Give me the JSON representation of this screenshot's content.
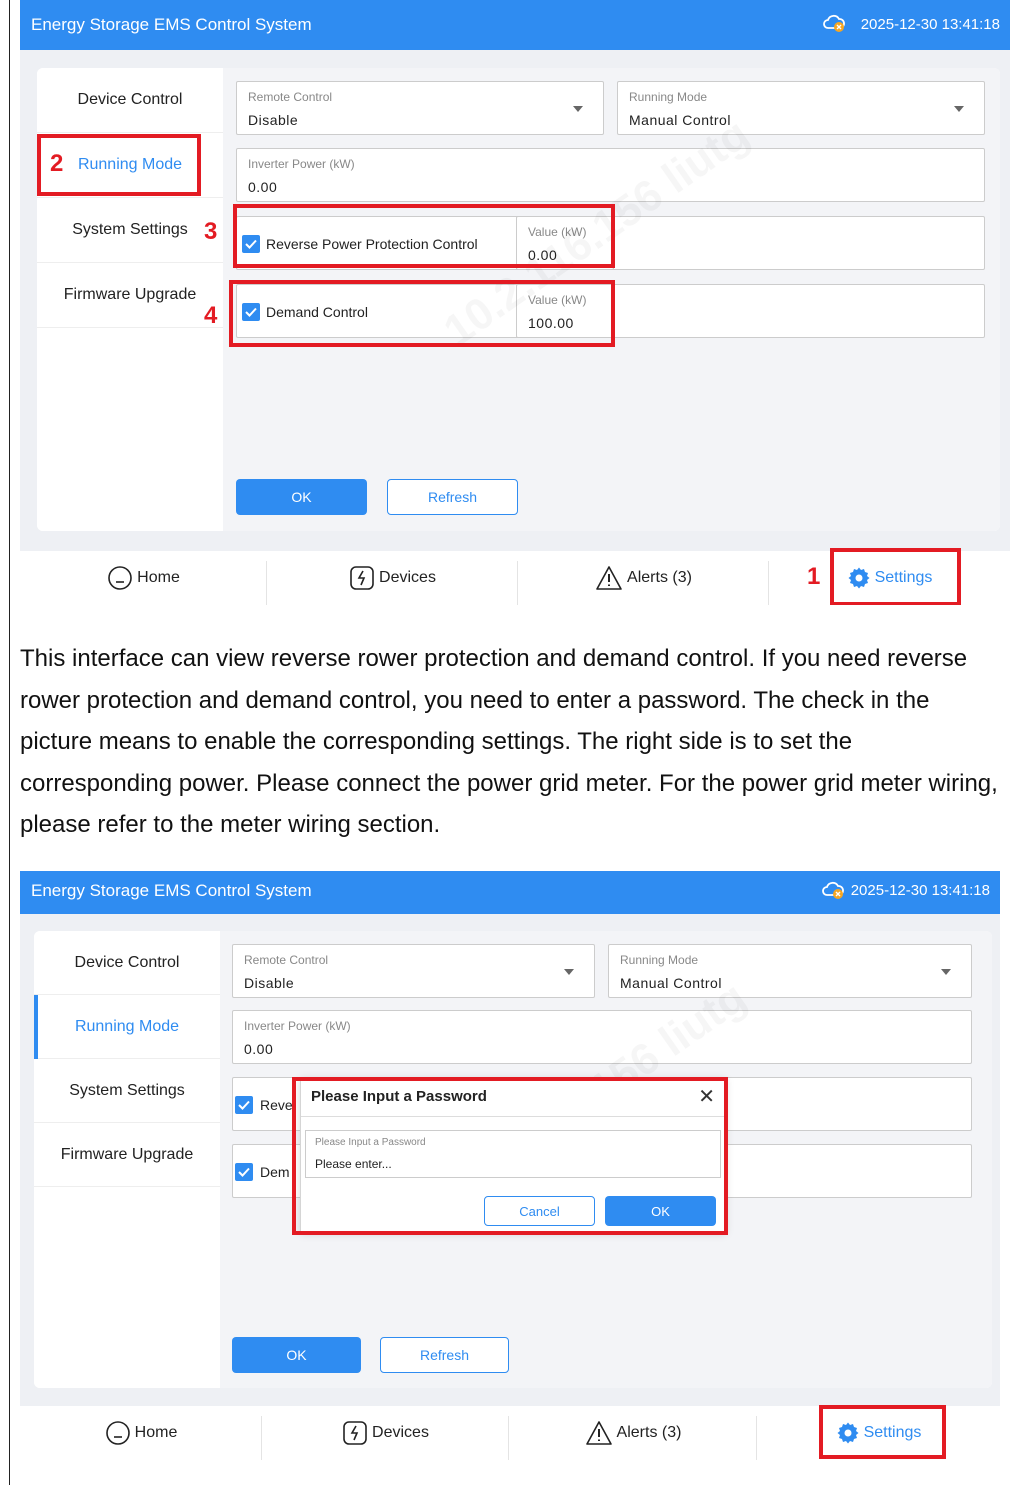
{
  "top_screen": {
    "app_title": "Energy Storage EMS Control System",
    "datetime": "2025-12-30 13:41:18",
    "nav": [
      {
        "label": "Device Control"
      },
      {
        "label": "Running Mode"
      },
      {
        "label": "System Settings"
      },
      {
        "label": "Firmware Upgrade"
      }
    ],
    "remote_control": {
      "label": "Remote Control",
      "value": "Disable"
    },
    "running_mode": {
      "label": "Running Mode",
      "value": "Manual Control"
    },
    "inverter_power": {
      "label": "Inverter Power (kW)",
      "value": "0.00"
    },
    "reverse_power": {
      "label": "Reverse Power Protection Control",
      "checked": true,
      "value_label": "Value (kW)",
      "value": "0.00"
    },
    "demand": {
      "label": "Demand Control",
      "checked": true,
      "value_label": "Value (kW)",
      "value": "100.00"
    },
    "ok_label": "OK",
    "refresh_label": "Refresh",
    "tabs": [
      {
        "label": "Home",
        "icon": "home-icon"
      },
      {
        "label": "Devices",
        "icon": "devices-icon"
      },
      {
        "label": "Alerts (3)",
        "icon": "alert-icon"
      },
      {
        "label": "Settings",
        "icon": "gear-icon"
      }
    ],
    "annotations": [
      "1",
      "2",
      "3",
      "4"
    ]
  },
  "description": "This interface can view reverse rower protection and demand control. If you need reverse rower protection and demand control, you need to enter a password. The check in the picture means to enable the corresponding settings. The right side is to set the corresponding power. Please connect the power grid meter. For the power grid meter wiring, please refer to the meter wiring section.",
  "bottom_screen": {
    "app_title": "Energy Storage EMS Control System",
    "datetime": "2025-12-30 13:41:18",
    "nav": [
      {
        "label": "Device Control"
      },
      {
        "label": "Running Mode"
      },
      {
        "label": "System Settings"
      },
      {
        "label": "Firmware Upgrade"
      }
    ],
    "remote_control": {
      "label": "Remote Control",
      "value": "Disable"
    },
    "running_mode": {
      "label": "Running Mode",
      "value": "Manual Control"
    },
    "inverter_power": {
      "label": "Inverter Power (kW)",
      "value": "0.00"
    },
    "reverse_partial": "Reve",
    "demand_partial": "Dem",
    "dialog": {
      "title": "Please Input a Password",
      "field_label": "Please Input a Password",
      "placeholder": "Please enter...",
      "cancel_label": "Cancel",
      "ok_label": "OK"
    },
    "ok_label": "OK",
    "refresh_label": "Refresh",
    "tabs": [
      {
        "label": "Home",
        "icon": "home-icon"
      },
      {
        "label": "Devices",
        "icon": "devices-icon"
      },
      {
        "label": "Alerts (3)",
        "icon": "alert-icon"
      },
      {
        "label": "Settings",
        "icon": "gear-icon"
      }
    ]
  },
  "colors": {
    "primary": "#2f8cf1",
    "annotation_red": "#e31b23",
    "title_bar": "#2f8cf1"
  }
}
